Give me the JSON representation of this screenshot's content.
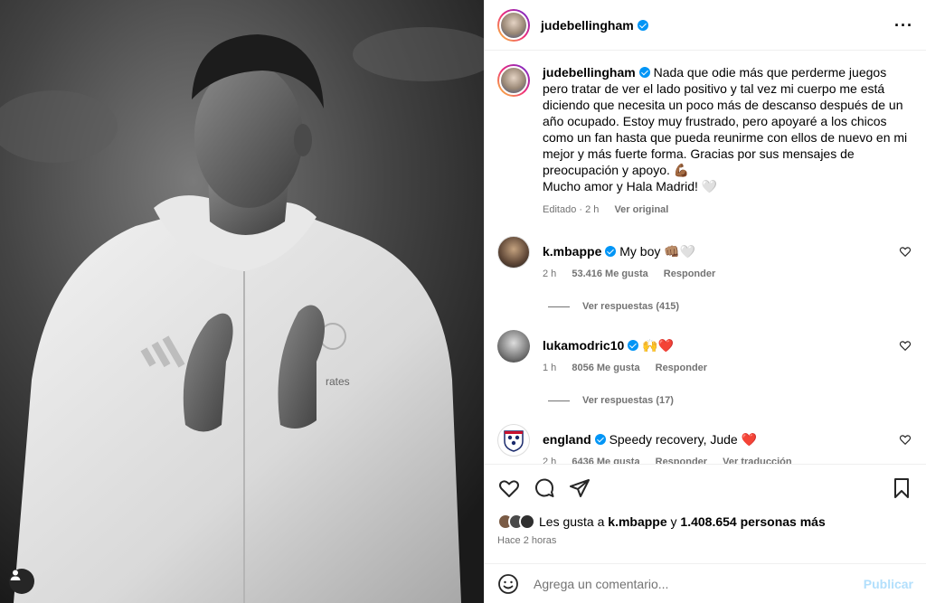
{
  "post": {
    "username": "judebellingham",
    "caption": "Nada que odie más que perderme juegos pero tratar de ver el lado positivo y tal vez mi cuerpo me está diciendo que necesita un poco más de descanso después de un año ocupado. Estoy muy frustrado, pero apoyaré a los chicos como un fan hasta que pueda reunirme con ellos de nuevo en mi mejor y más fuerte forma. Gracias por sus mensajes de preocupación y apoyo. 💪🏾",
    "caption_line2": "Mucho amor y Hala Madrid! 🤍",
    "edited": "Editado · 2 h",
    "see_original": "Ver original",
    "photo_text": "rates"
  },
  "comments": [
    {
      "username": "k.mbappe",
      "text": "My boy 👊🏽🤍",
      "time": "2 h",
      "likes": "53.416 Me gusta",
      "reply": "Responder",
      "replies": "Ver respuestas (415)"
    },
    {
      "username": "lukamodric10",
      "text": "🙌❤️",
      "time": "1 h",
      "likes": "8056 Me gusta",
      "reply": "Responder",
      "replies": "Ver respuestas (17)"
    },
    {
      "username": "england",
      "text": "Speedy recovery, Jude ❤️",
      "time": "2 h",
      "likes": "6436 Me gusta",
      "reply": "Responder",
      "translate": "Ver traducción"
    }
  ],
  "likes": {
    "prefix": "Les gusta a",
    "user": "k.mbappe",
    "connector": "y",
    "count": "1.408.654 personas más"
  },
  "time_ago": "Hace 2 horas",
  "composer": {
    "placeholder": "Agrega un comentario...",
    "publish": "Publicar"
  },
  "colors": {
    "verified": "#0095f6",
    "muted": "#737373",
    "publish_disabled": "#b2dffc"
  }
}
